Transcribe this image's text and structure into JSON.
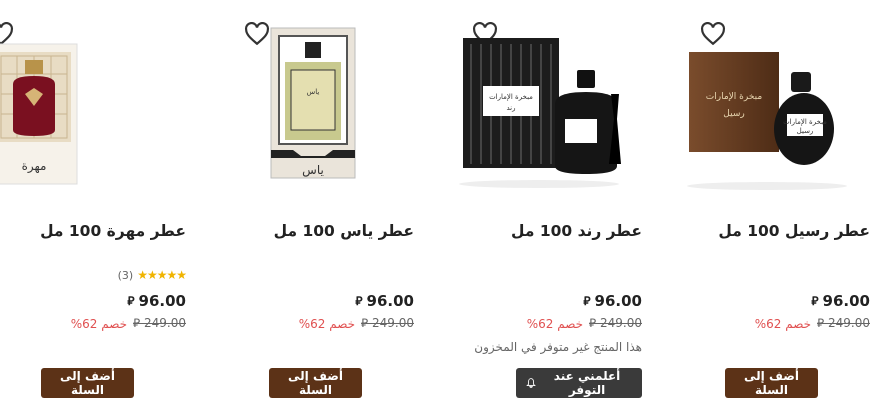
{
  "products": [
    {
      "title": "عطر رسيل 100 مل",
      "price": "96.00",
      "currency": "ريال",
      "old_price": "249.00",
      "discount": "خصم 62%",
      "button": "أضف إلى السلة",
      "image_label": "مبخرة الإمارات رسيل"
    },
    {
      "title": "عطر رند 100 مل",
      "price": "96.00",
      "currency": "ريال",
      "old_price": "249.00",
      "discount": "خصم 62%",
      "stock_note": "هذا المنتج غير متوفر في المخزون",
      "button": "أعلمني عند التوفر",
      "image_label": "مبخرة الإمارات رند"
    },
    {
      "title": "عطر ياس 100 مل",
      "price": "96.00",
      "currency": "ريال",
      "old_price": "249.00",
      "discount": "خصم 62%",
      "button": "أضف إلى السلة",
      "image_label": "ياس"
    },
    {
      "title": "عطر مهرة 100 مل",
      "rating_stars": 5,
      "rating_count": "(3)",
      "price": "96.00",
      "currency": "ريال",
      "old_price": "249.00",
      "discount": "خصم 62%",
      "button": "أضف إلى السلة",
      "image_label": "مهرة"
    }
  ],
  "colors": {
    "primary_button": "#5c3217",
    "notify_button": "#3a3a3a",
    "discount": "#e05050",
    "star": "#f0b400"
  },
  "icons": {
    "favorite": "heart-outline-icon",
    "currency": "saudi-riyal-icon",
    "notify": "bell-icon"
  }
}
